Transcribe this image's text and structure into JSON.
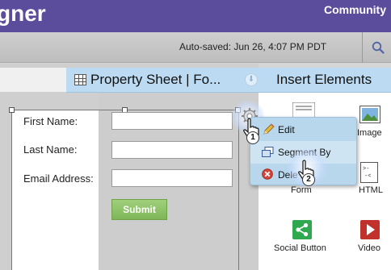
{
  "header": {
    "app_title": "gner",
    "community_link": "Community",
    "autosaved_text": "Auto-saved: Jun 26, 4:07 PM PDT",
    "search_icon": "search-icon"
  },
  "property_bar": {
    "title": "Property Sheet | Fo...",
    "insert_title": "Insert Elements",
    "grid_icon": "grid-icon",
    "collapse_icon": "down-arrow-circle-icon"
  },
  "form": {
    "fields": [
      {
        "label": "First Name:"
      },
      {
        "label": "Last Name:"
      },
      {
        "label": "Email Address:"
      }
    ],
    "submit_label": "Submit"
  },
  "context_menu": {
    "items": [
      {
        "label": "Edit",
        "icon": "pencil-icon"
      },
      {
        "label": "Segment By",
        "icon": "segment-icon"
      },
      {
        "label": "Dele",
        "icon": "delete-icon"
      }
    ]
  },
  "palette": {
    "items": [
      {
        "label": "Image",
        "icon": "image-icon"
      },
      {
        "label": "Form",
        "icon": "form-icon"
      },
      {
        "label": "HTML",
        "icon": "html-icon"
      },
      {
        "label": "Social Button",
        "icon": "share-icon"
      },
      {
        "label": "Video",
        "icon": "play-icon"
      }
    ]
  },
  "markers": [
    "1",
    "2"
  ],
  "colors": {
    "header_purple": "#5c4d9c",
    "property_bar_blue": "#bcdbf2",
    "submit_green": "#8cc267",
    "social_green": "#2fa84f",
    "video_red": "#c0322b"
  }
}
